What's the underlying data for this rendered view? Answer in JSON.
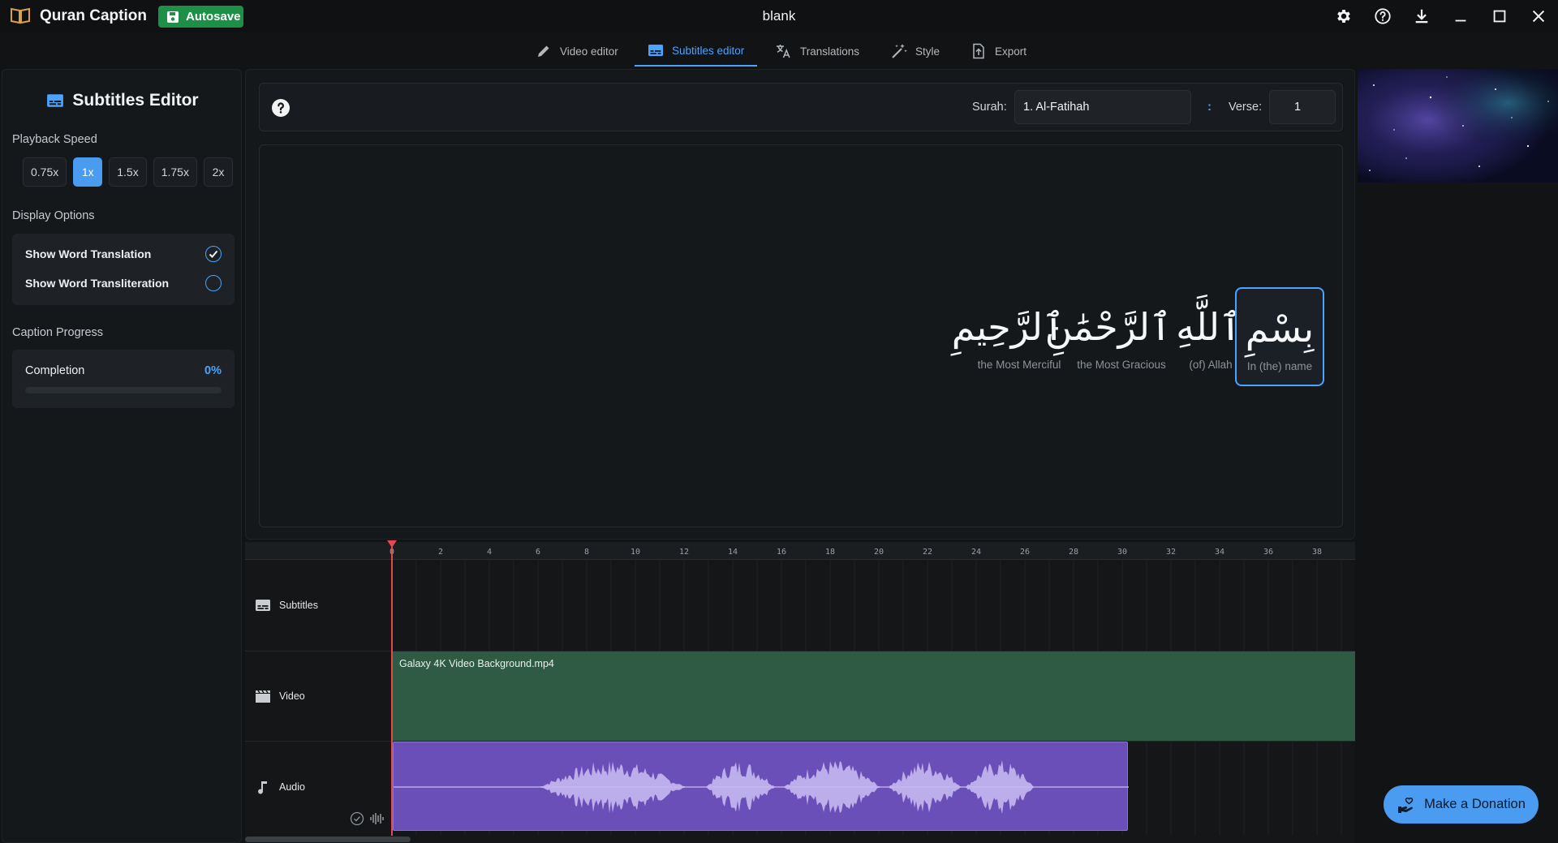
{
  "app": {
    "name": "Quran Caption",
    "autosave_label": "Autosave",
    "window_title": "blank"
  },
  "tabs": [
    {
      "label": "Video editor",
      "icon": "pencil-icon",
      "active": false
    },
    {
      "label": "Subtitles editor",
      "icon": "subtitles-icon",
      "active": true
    },
    {
      "label": "Translations",
      "icon": "translate-icon",
      "active": false
    },
    {
      "label": "Style",
      "icon": "magic-wand-icon",
      "active": false
    },
    {
      "label": "Export",
      "icon": "export-icon",
      "active": false
    }
  ],
  "sidebar": {
    "title": "Subtitles Editor",
    "playback_label": "Playback Speed",
    "speeds": [
      "0.75x",
      "1x",
      "1.5x",
      "1.75x",
      "2x"
    ],
    "active_speed": "1x",
    "display_label": "Display Options",
    "options": [
      {
        "label": "Show Word Translation",
        "checked": true
      },
      {
        "label": "Show Word Transliteration",
        "checked": false
      }
    ],
    "progress_section_label": "Caption Progress",
    "completion_label": "Completion",
    "completion_value": "0%",
    "completion_fraction": 0
  },
  "verse_bar": {
    "surah_label": "Surah:",
    "surah_value": "1. Al-Fatihah",
    "separator": ":",
    "verse_label": "Verse:",
    "verse_value": "1"
  },
  "words": [
    {
      "arabic": "ٱلرَّحِيمِ",
      "translation": "the Most Merciful",
      "selected": false
    },
    {
      "arabic": "ٱلرَّحْمَٰنِ",
      "translation": "the Most Gracious",
      "selected": false
    },
    {
      "arabic": "ٱللَّهِ",
      "translation": "(of) Allah",
      "selected": false
    },
    {
      "arabic": "بِسْمِ",
      "translation": "In (the) name",
      "selected": true
    }
  ],
  "timeline": {
    "ticks": [
      "0",
      "2",
      "4",
      "6",
      "8",
      "10",
      "12",
      "14",
      "16",
      "18",
      "20",
      "22",
      "24",
      "26",
      "28",
      "30",
      "32",
      "34",
      "36",
      "38"
    ],
    "tracks": [
      "Subtitles",
      "Video",
      "Audio"
    ],
    "video_clip_name": "Galaxy 4K Video Background.mp4"
  },
  "donate_label": "Make a Donation",
  "colors": {
    "accent": "#4aa3ff",
    "autosave": "#1e8f46",
    "video_clip": "#2f5b45",
    "audio_clip": "#6b4fb8",
    "playhead": "#e5484d"
  }
}
